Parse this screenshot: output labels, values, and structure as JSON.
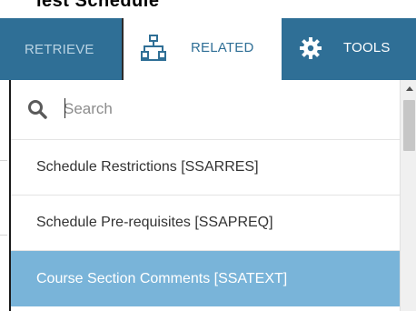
{
  "top_fragment": {
    "text": "lest Schedule"
  },
  "toolbar": {
    "retrieve_label": "RETRIEVE",
    "related_label": "RELATED",
    "tools_label": "TOOLS"
  },
  "search": {
    "placeholder": "Search",
    "value": ""
  },
  "menu": {
    "items": [
      {
        "label": "Schedule Restrictions [SSARRES]"
      },
      {
        "label": "Schedule Pre-requisites [SSAPREQ]"
      },
      {
        "label": "Course Section Comments [SSATEXT]",
        "selected": true
      }
    ]
  },
  "colors": {
    "toolbar_bg": "#2f6f96",
    "active_tab_bg": "#ffffff",
    "active_tab_text": "#2f6f96",
    "highlight_bg": "#79b4d9"
  },
  "icons": {
    "related": "sitemap-icon",
    "tools": "gear-icon",
    "search": "search-icon",
    "scroll_up": "chevron-up-icon"
  }
}
